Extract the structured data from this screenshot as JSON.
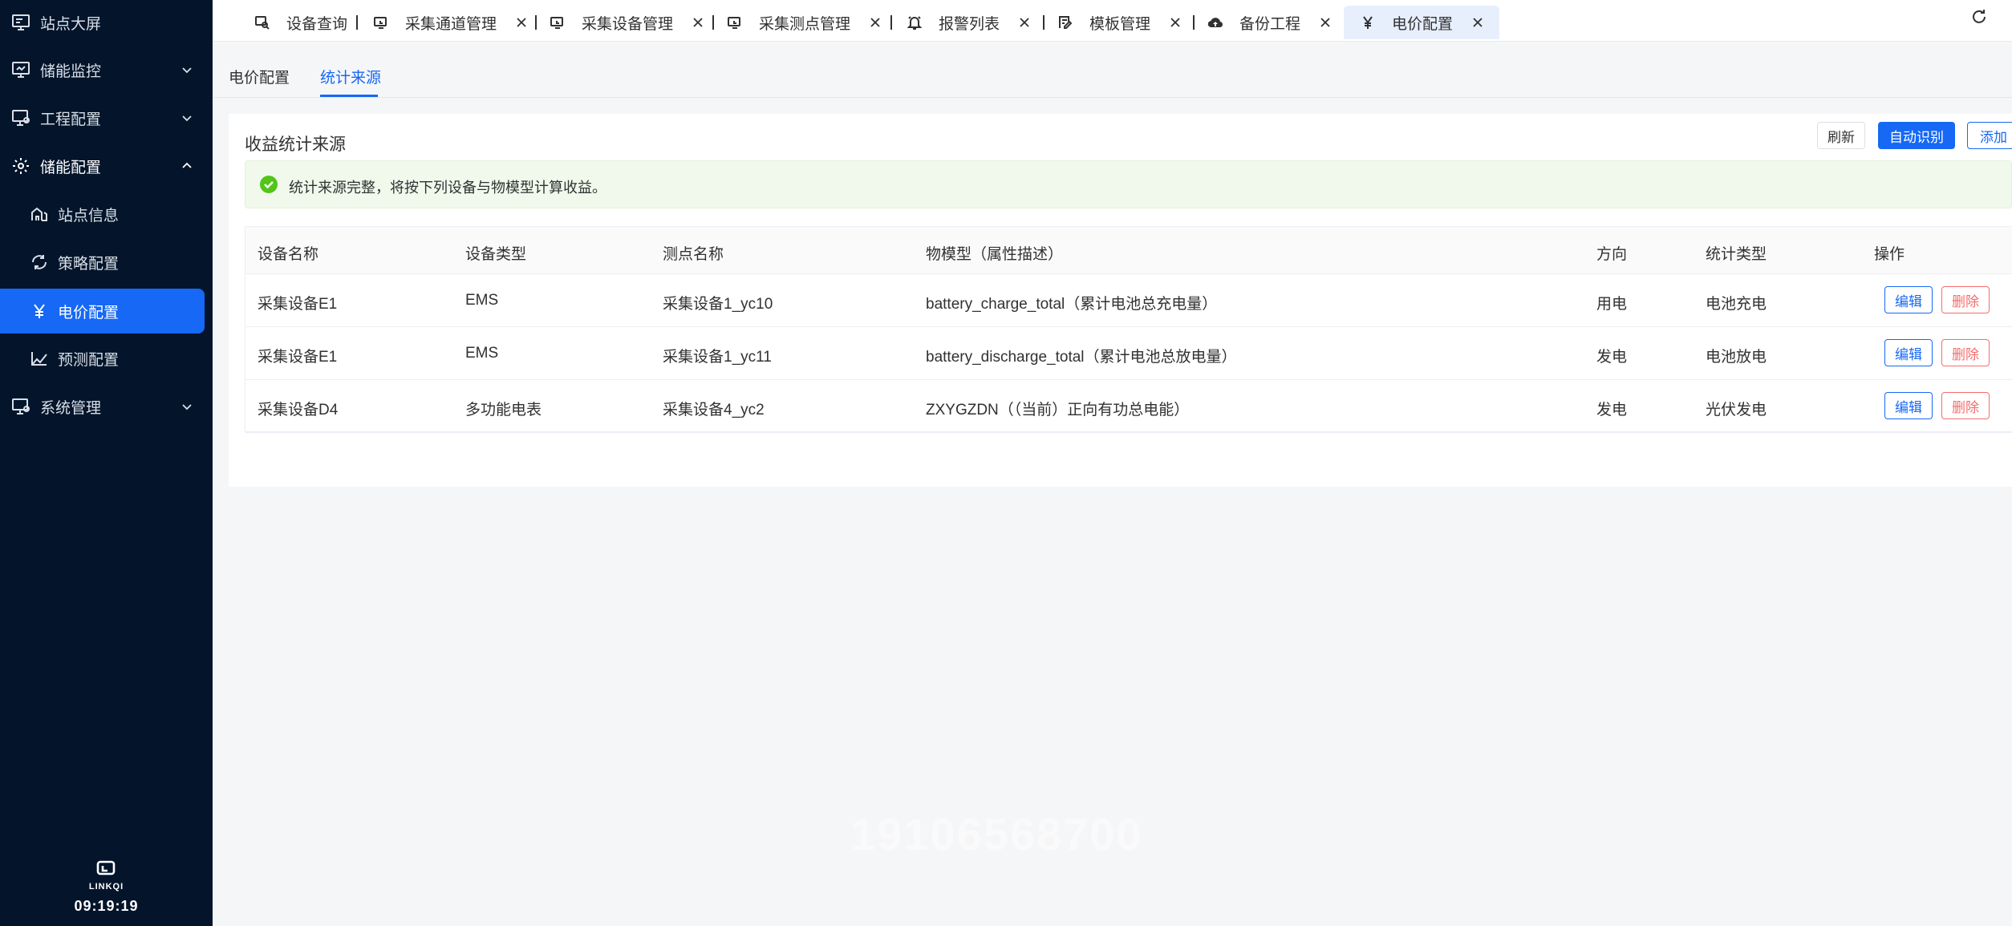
{
  "sidebar": {
    "items": [
      {
        "label": "站点大屏",
        "icon": "monitor-icon"
      },
      {
        "label": "储能监控",
        "icon": "monitor-icon"
      },
      {
        "label": "工程配置",
        "icon": "project-config-icon"
      },
      {
        "label": "储能配置",
        "icon": "gear-icon"
      },
      {
        "label": "站点信息",
        "icon": "site-icon"
      },
      {
        "label": "策略配置",
        "icon": "strategy-icon"
      },
      {
        "label": "电价配置",
        "icon": "yen-icon"
      },
      {
        "label": "预测配置",
        "icon": "forecast-icon"
      },
      {
        "label": "系统管理",
        "icon": "system-icon"
      }
    ],
    "brand": "LINKQI",
    "clock": "09:19:19"
  },
  "tabs": [
    {
      "label": "设备查询",
      "icon": "search-icon"
    },
    {
      "label": "采集通道管理",
      "icon": "device-icon"
    },
    {
      "label": "采集设备管理",
      "icon": "device-icon"
    },
    {
      "label": "采集测点管理",
      "icon": "device-icon"
    },
    {
      "label": "报警列表",
      "icon": "bell-icon"
    },
    {
      "label": "模板管理",
      "icon": "template-icon"
    },
    {
      "label": "备份工程",
      "icon": "cloud-upload-icon"
    },
    {
      "label": "电价配置",
      "icon": "yen-icon"
    }
  ],
  "subtabs": [
    "电价配置",
    "统计来源"
  ],
  "card": {
    "title": "收益统计来源",
    "buttons": {
      "refresh": "刷新",
      "auto": "自动识别",
      "add": "添加"
    },
    "alert": "统计来源完整，将按下列设备与物模型计算收益。"
  },
  "table": {
    "headers": [
      "设备名称",
      "设备类型",
      "测点名称",
      "物模型（属性描述）",
      "方向",
      "统计类型",
      "操作"
    ],
    "rows": [
      [
        "采集设备E1",
        "EMS",
        "采集设备1_yc10",
        "battery_charge_total（累计电池总充电量）",
        "用电",
        "电池充电"
      ],
      [
        "采集设备E1",
        "EMS",
        "采集设备1_yc11",
        "battery_discharge_total（累计电池总放电量）",
        "发电",
        "电池放电"
      ],
      [
        "采集设备D4",
        "多功能电表",
        "采集设备4_yc2",
        "ZXYGZDN（（当前）正向有功总电能）",
        "发电",
        "光伏发电"
      ]
    ],
    "actions": {
      "edit": "编辑",
      "delete": "删除"
    }
  },
  "watermark": "19106568700",
  "colors": {
    "primary": "#1668f5",
    "sidebar": "#04152b",
    "danger": "#f56c6c",
    "success": "#52c41a"
  }
}
